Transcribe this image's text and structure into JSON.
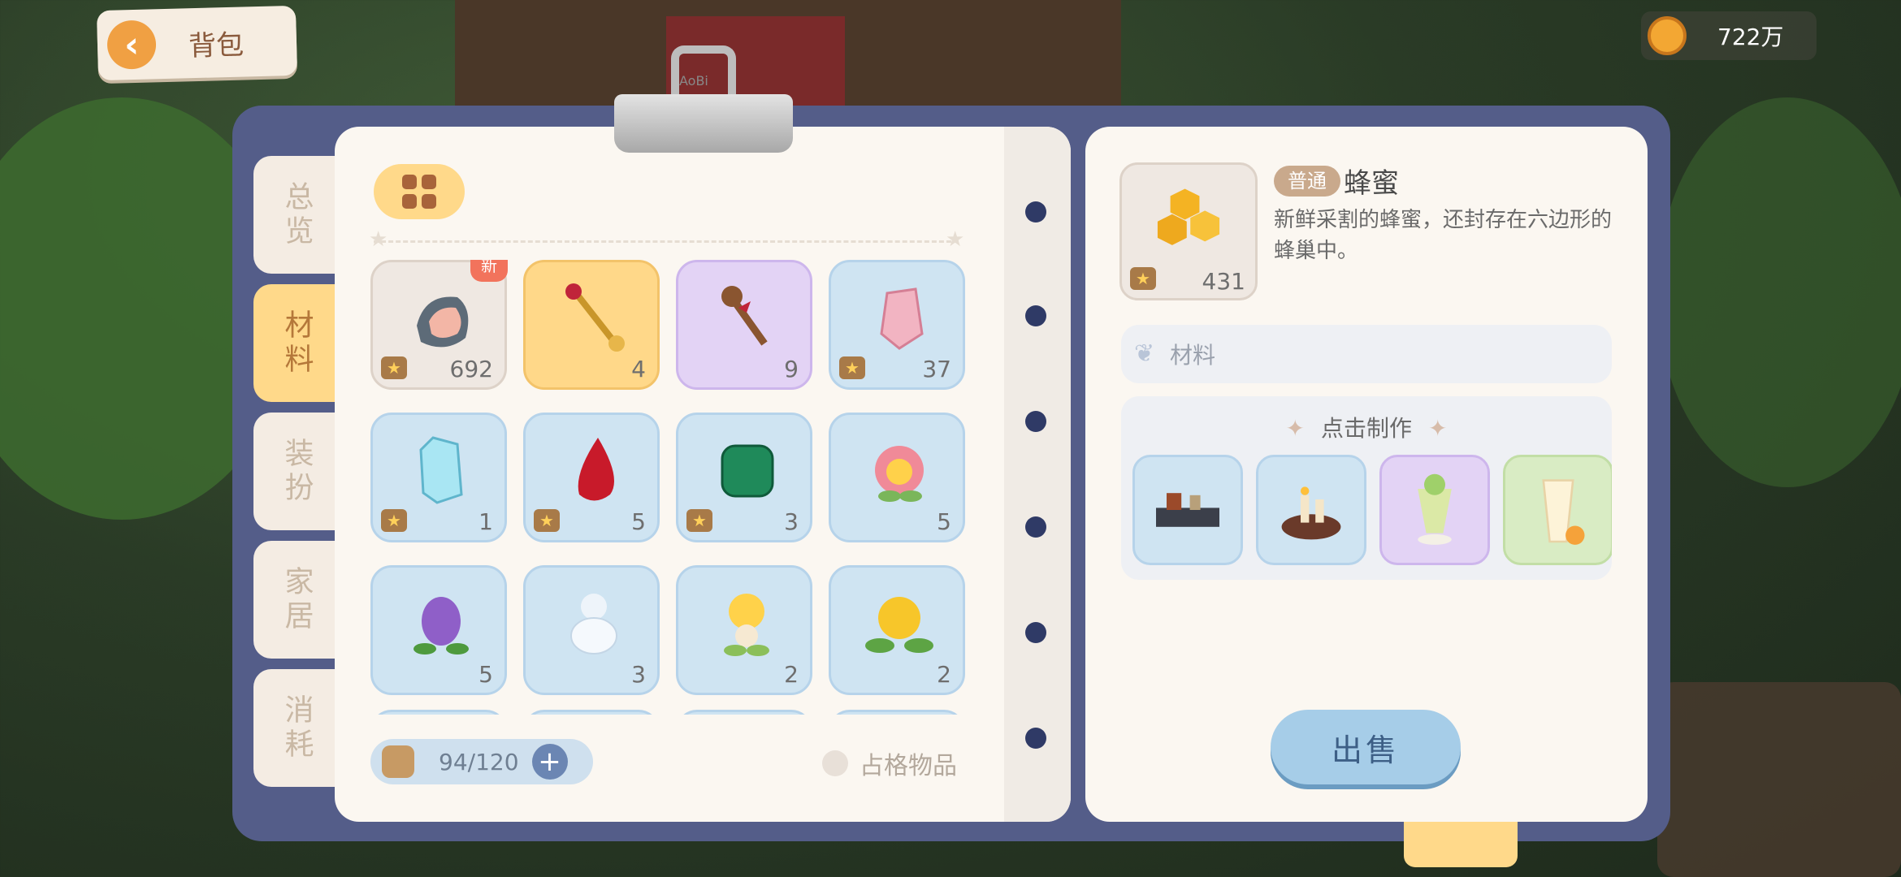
{
  "header": {
    "back_label": "背包",
    "currency_value": "722万"
  },
  "clip_brand": "AoBi",
  "tabs": [
    {
      "label": "总览",
      "active": false
    },
    {
      "label": "材料",
      "active": true
    },
    {
      "label": "装扮",
      "active": false
    },
    {
      "label": "家居",
      "active": false
    },
    {
      "label": "消耗",
      "active": false
    }
  ],
  "items": [
    {
      "icon": "meat-icon",
      "count": "692",
      "new_tag": "新"
    },
    {
      "icon": "golden-key-icon",
      "count": "4"
    },
    {
      "icon": "bear-key-icon",
      "count": "9"
    },
    {
      "icon": "pink-crystal-icon",
      "count": "37"
    },
    {
      "icon": "diamond-icon",
      "count": "1"
    },
    {
      "icon": "ruby-icon",
      "count": "5"
    },
    {
      "icon": "emerald-icon",
      "count": "3"
    },
    {
      "icon": "pink-flower-icon",
      "count": "5"
    },
    {
      "icon": "grape-flower-icon",
      "count": "5"
    },
    {
      "icon": "cloud-sprite-icon",
      "count": "3"
    },
    {
      "icon": "light-sprite-icon",
      "count": "2"
    },
    {
      "icon": "yellow-flower-icon",
      "count": "2"
    }
  ],
  "capacity": "94/120",
  "occupy_label": "占格物品",
  "detail": {
    "rarity": "普通",
    "name": "蜂蜜",
    "count": "431",
    "description": "新鲜采割的蜂蜜，还封存在六边形的蜂巢中。",
    "type_label": "材料",
    "craft_title": "点击制作",
    "craft_items": [
      "bench-icon",
      "candle-cake-icon",
      "parfait-icon",
      "drink-icon"
    ],
    "sell_label": "出售"
  },
  "colors": {
    "book": "#545d89",
    "page": "#fbf7f1",
    "accent": "#ffd98a",
    "sell": "#a6cde8"
  }
}
